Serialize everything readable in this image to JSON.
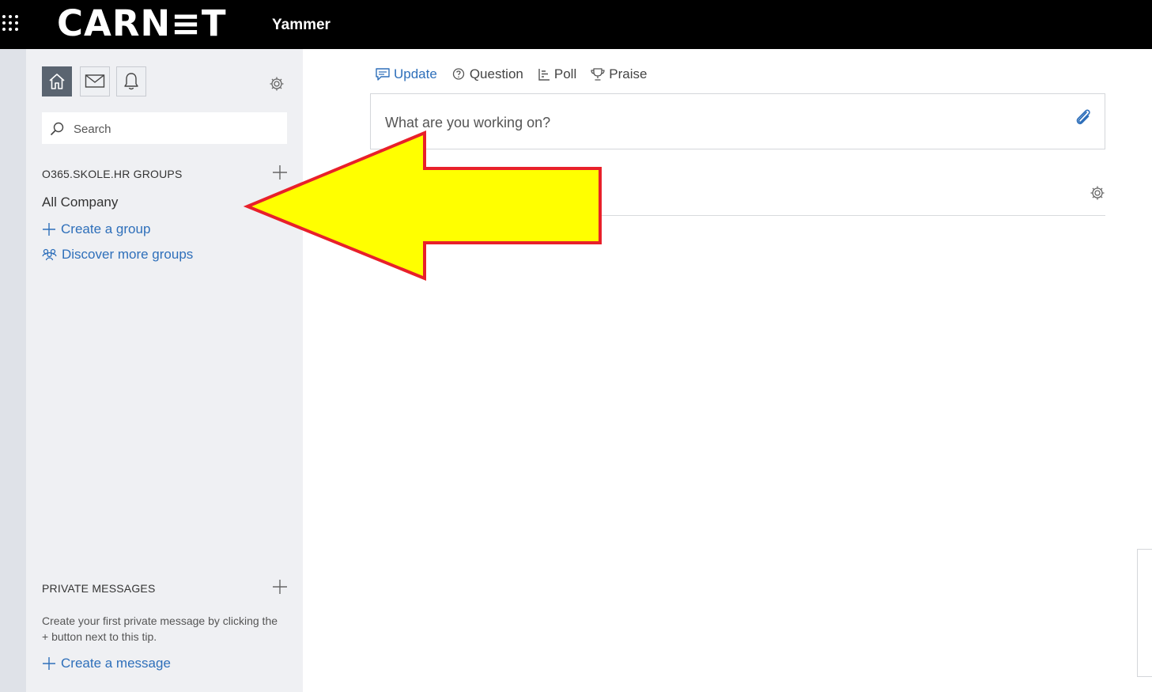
{
  "header": {
    "brand": "CARN≡T",
    "product": "Yammer"
  },
  "sidebar": {
    "search": {
      "placeholder": "Search"
    },
    "groups_title": "O365.SKOLE.HR GROUPS",
    "groups": [
      {
        "label": "All Company"
      }
    ],
    "create_group": "Create a group",
    "discover_groups": "Discover more groups",
    "private_messages_title": "PRIVATE MESSAGES",
    "private_messages_tip": "Create your first private message by clicking the + button next to this tip.",
    "create_message": "Create a message"
  },
  "main": {
    "tabs": [
      {
        "label": "Update",
        "icon": "chat-bubble-icon",
        "active": true
      },
      {
        "label": "Question",
        "icon": "question-bubble-icon",
        "active": false
      },
      {
        "label": "Poll",
        "icon": "poll-icon",
        "active": false
      },
      {
        "label": "Praise",
        "icon": "trophy-icon",
        "active": false
      }
    ],
    "composer": {
      "placeholder": "What are you working on?"
    }
  },
  "annotation": {
    "arrow_fill": "#ffff00",
    "arrow_stroke": "#e8202a"
  },
  "colors": {
    "accent": "#2e6fba",
    "topbar": "#000000",
    "sidebar": "#eff0f3"
  }
}
